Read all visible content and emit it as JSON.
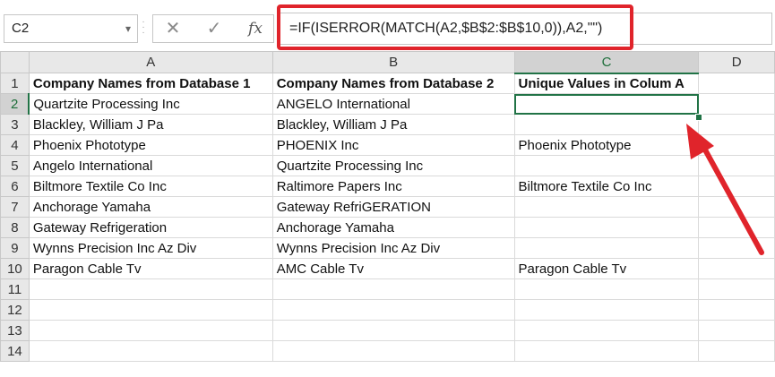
{
  "formula_bar": {
    "name_box": "C2",
    "cancel_icon": "close-icon",
    "enter_icon": "check-icon",
    "fx_label": "fx",
    "formula": "=IF(ISERROR(MATCH(A2,$B$2:$B$10,0)),A2,\"\")"
  },
  "grid": {
    "columns": [
      "A",
      "B",
      "C",
      "D"
    ],
    "rows": [
      {
        "num": "1",
        "cells": [
          "Company Names from Database 1",
          "Company Names from Database 2",
          "Unique Values in Colum A",
          ""
        ]
      },
      {
        "num": "2",
        "cells": [
          "Quartzite Processing Inc",
          "ANGELO International",
          "",
          ""
        ]
      },
      {
        "num": "3",
        "cells": [
          "Blackley, William J Pa",
          "Blackley, William J Pa",
          "",
          ""
        ]
      },
      {
        "num": "4",
        "cells": [
          "Phoenix Phototype",
          "PHOENIX Inc",
          "Phoenix Phototype",
          ""
        ]
      },
      {
        "num": "5",
        "cells": [
          "Angelo International",
          "Quartzite Processing Inc",
          "",
          ""
        ]
      },
      {
        "num": "6",
        "cells": [
          "Biltmore Textile Co Inc",
          "Raltimore Papers Inc",
          "Biltmore Textile Co Inc",
          ""
        ]
      },
      {
        "num": "7",
        "cells": [
          "Anchorage Yamaha",
          "Gateway RefriGERATION",
          "",
          ""
        ]
      },
      {
        "num": "8",
        "cells": [
          "Gateway Refrigeration",
          "Anchorage Yamaha",
          "",
          ""
        ]
      },
      {
        "num": "9",
        "cells": [
          "Wynns Precision Inc Az Div",
          "Wynns Precision Inc Az Div",
          "",
          ""
        ]
      },
      {
        "num": "10",
        "cells": [
          "Paragon Cable Tv",
          "AMC Cable Tv",
          "Paragon Cable Tv",
          ""
        ]
      },
      {
        "num": "11",
        "cells": [
          "",
          "",
          "",
          ""
        ]
      },
      {
        "num": "12",
        "cells": [
          "",
          "",
          "",
          ""
        ]
      },
      {
        "num": "13",
        "cells": [
          "",
          "",
          "",
          ""
        ]
      },
      {
        "num": "14",
        "cells": [
          "",
          "",
          "",
          ""
        ]
      }
    ]
  },
  "colors": {
    "accent_green": "#217346",
    "annotation_red": "#e0242b"
  }
}
